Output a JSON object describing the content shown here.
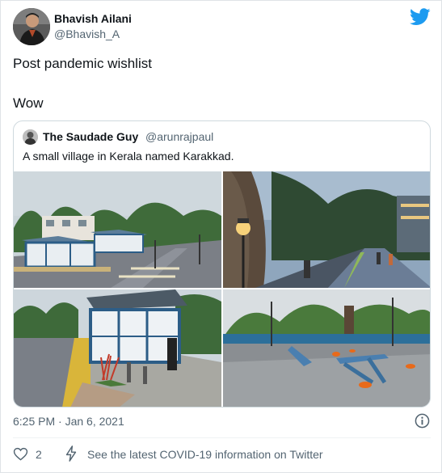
{
  "tweet": {
    "author_name": "Bhavish Ailani",
    "author_handle": "@Bhavish_A",
    "text_line1": "Post pandemic wishlist",
    "text_line2": "Wow",
    "timestamp": "6:25 PM · Jan 6, 2021",
    "like_count": "2",
    "covid_link": "See the latest COVID-19 information on Twitter"
  },
  "quoted": {
    "author_name": "The Saudade Guy",
    "author_handle": "@arunrajpaul",
    "text": "A small village in Kerala named Karakkad."
  },
  "icons": {
    "brand": "twitter-bird-icon",
    "info": "info-icon",
    "like": "heart-icon",
    "covid": "lightning-bolt-icon"
  },
  "colors": {
    "brand": "#1d9bf0",
    "primary_text": "#0f1419",
    "secondary_text": "#536471",
    "border": "#cfd9de"
  }
}
